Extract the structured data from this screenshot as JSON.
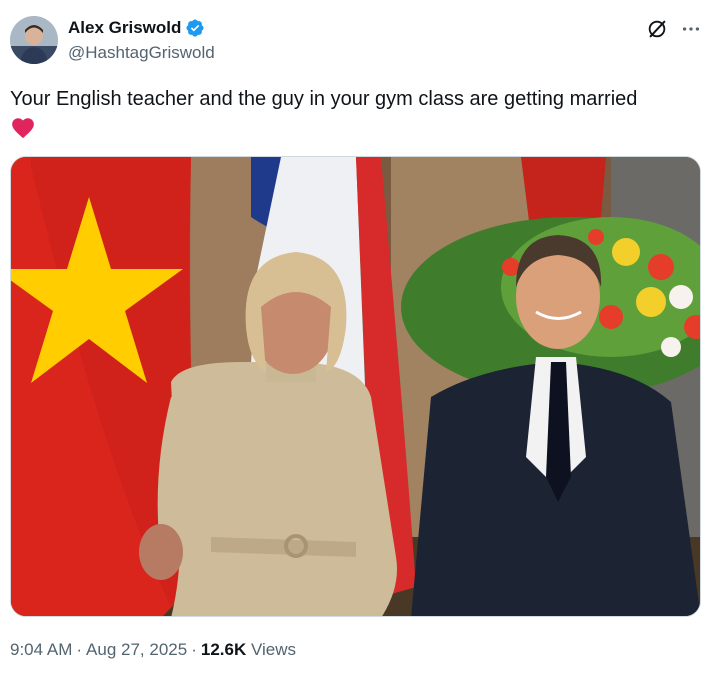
{
  "author": {
    "display_name": "Alex Griswold",
    "handle": "@HashtagGriswold",
    "verified": true,
    "verified_color": "#1d9bf0"
  },
  "tweet": {
    "text": "Your English teacher and the guy in your gym class are getting married",
    "emoji": "heart-emoji",
    "emoji_color": "#e0245e"
  },
  "meta": {
    "time": "9:04 AM",
    "dot1": "·",
    "date": "Aug 27, 2025",
    "dot2": "·",
    "views_count": "12.6K",
    "views_label": "Views"
  },
  "icons": {
    "grok": "grok-icon",
    "more": "more-icon"
  },
  "colors": {
    "text": "#0f1419",
    "secondary": "#536471",
    "vietnam_flag_red": "#da251d",
    "vietnam_flag_star": "#ffcd00",
    "france_blue": "#1f3a8a",
    "france_red": "#d72b2b"
  }
}
